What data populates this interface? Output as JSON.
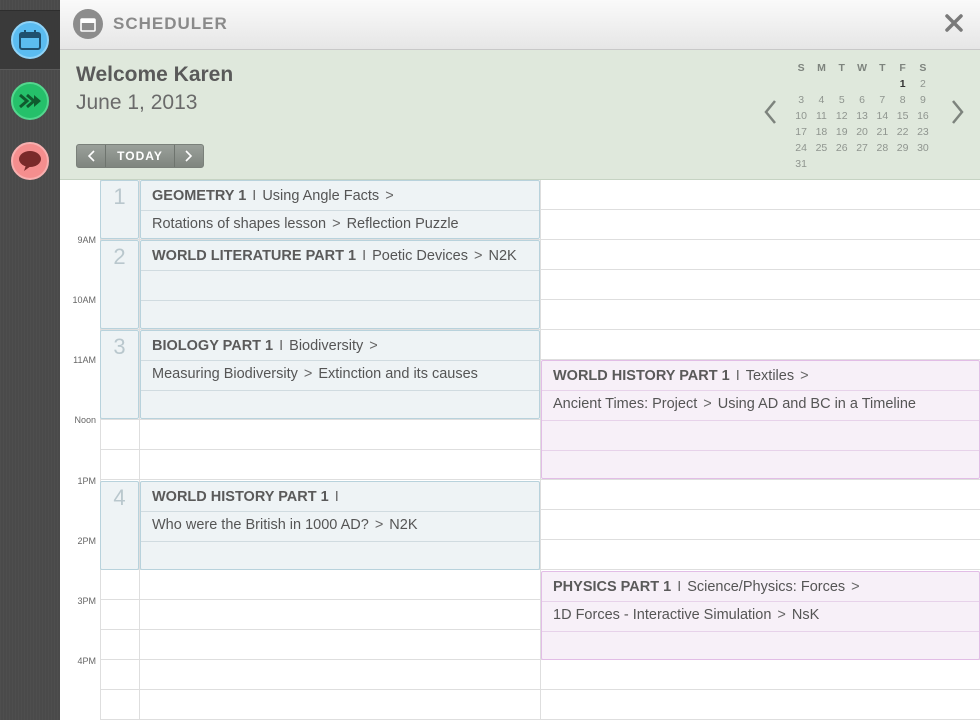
{
  "app": {
    "title": "SCHEDULER",
    "close_icon": "close-icon"
  },
  "rail": {
    "items": [
      {
        "icon": "calendar-icon",
        "color": "#5bbcf0"
      },
      {
        "icon": "forward-icon",
        "color": "#25c06a"
      },
      {
        "icon": "chat-icon",
        "color": "#f58e8e"
      }
    ]
  },
  "header": {
    "welcome": "Welcome Karen",
    "date": "June 1, 2013",
    "prev_label": "‹",
    "today_label": "TODAY",
    "next_label": "›"
  },
  "mini_calendar": {
    "weekdays": [
      "S",
      "M",
      "T",
      "W",
      "T",
      "F",
      "S"
    ],
    "weeks": [
      [
        "",
        "",
        "",
        "",
        "",
        "1",
        "2"
      ],
      [
        "3",
        "4",
        "5",
        "6",
        "7",
        "8",
        "9"
      ],
      [
        "10",
        "11",
        "12",
        "13",
        "14",
        "15",
        "16"
      ],
      [
        "17",
        "18",
        "19",
        "20",
        "21",
        "22",
        "23"
      ],
      [
        "24",
        "25",
        "26",
        "27",
        "28",
        "29",
        "30"
      ],
      [
        "31",
        "",
        "",
        "",
        "",
        "",
        ""
      ]
    ],
    "today": "1"
  },
  "times": [
    "9AM",
    "10AM",
    "11AM",
    "Noon",
    "1PM",
    "2PM",
    "3PM",
    "4PM"
  ],
  "periods": [
    "1",
    "2",
    "3",
    "4"
  ],
  "events": [
    {
      "title": "GEOMETRY 1",
      "topic": "Using Angle Facts",
      "topic_arrow": ">",
      "detail_a": "Rotations of shapes lesson",
      "detail_arrow": ">",
      "detail_b": "Reflection Puzzle"
    },
    {
      "title": "WORLD LITERATURE PART 1",
      "topic": "Poetic Devices",
      "topic_arrow": ">",
      "detail_a": "N2K"
    },
    {
      "title": "BIOLOGY PART 1",
      "topic": "Biodiversity",
      "topic_arrow": ">",
      "detail_a": "Measuring Biodiversity",
      "detail_arrow": ">",
      "detail_b": "Extinction and its causes"
    },
    {
      "title": "WORLD HISTORY PART 1",
      "topic": "",
      "detail_a": "Who were the British in 1000 AD?",
      "detail_arrow": ">",
      "detail_b": "N2K"
    },
    {
      "title": "WORLD HISTORY PART 1",
      "topic": "Textiles",
      "topic_arrow": ">",
      "detail_a": "Ancient Times: Project",
      "detail_arrow": ">",
      "detail_b": "Using AD and BC in a Timeline"
    },
    {
      "title": "PHYSICS PART 1",
      "topic": "Science/Physics: Forces",
      "topic_arrow": ">",
      "detail_a": "1D Forces - Interactive Simulation",
      "detail_arrow": ">",
      "detail_b": "NsK"
    }
  ],
  "separator": "I"
}
